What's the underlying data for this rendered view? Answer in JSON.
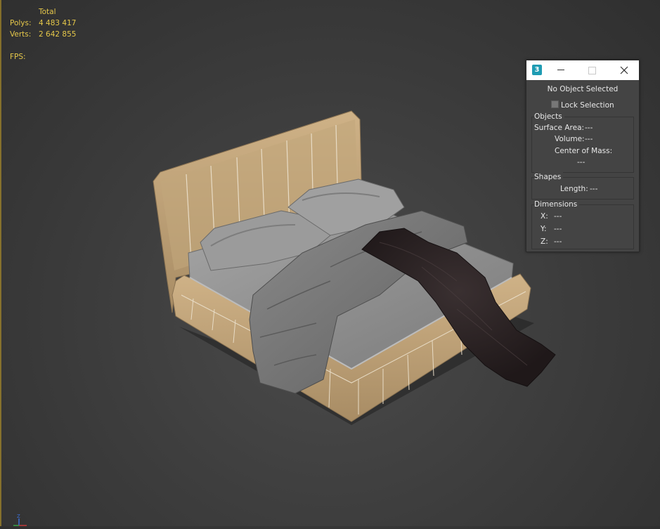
{
  "stats": {
    "header": "Total",
    "polys_label": "Polys:",
    "polys_value": "4 483 417",
    "verts_label": "Verts:",
    "verts_value": "2 642 855",
    "fps_label": "FPS:"
  },
  "measure": {
    "app_icon": "3",
    "icons": [
      "app-icon",
      "minimize-icon",
      "maximize-icon",
      "close-icon"
    ],
    "heading": "No Object Selected",
    "lock_label": "Lock Selection",
    "lock_checked": false,
    "objects": {
      "title": "Objects",
      "surface_area": "Surface Area:",
      "surface_area_value": "---",
      "volume": "Volume:",
      "volume_value": "---",
      "center_of_mass": "Center of Mass:",
      "center_value": "---"
    },
    "shapes": {
      "title": "Shapes",
      "length": "Length:",
      "length_value": "---"
    },
    "dimensions": {
      "title": "Dimensions",
      "x": "X:",
      "x_value": "---",
      "y": "Y:",
      "y_value": "---",
      "z": "Z:",
      "z_value": "---"
    }
  },
  "axis_label": "Z",
  "colors": {
    "stats_text": "#e6c84a",
    "viewport_bg": "#3e3e3e",
    "dialog_bg": "#444444",
    "frame": "#c4a57a",
    "sheet": "#9a9a9a",
    "fur": "#2c2425"
  }
}
